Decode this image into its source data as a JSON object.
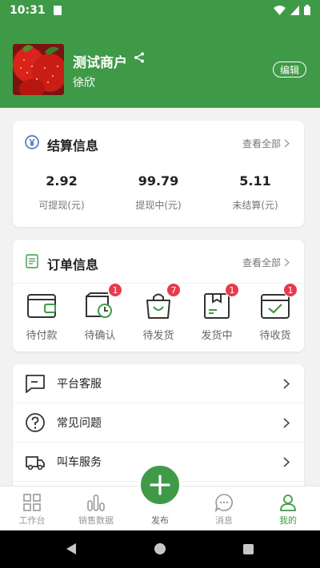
{
  "status_bar": {
    "time": "10:31"
  },
  "header": {
    "shop_name": "测试商户",
    "user_name": "徐欣",
    "edit_label": "编辑"
  },
  "settlement": {
    "title": "结算信息",
    "view_all": "查看全部",
    "items": [
      {
        "value": "2.92",
        "label": "可提现(元)"
      },
      {
        "value": "99.79",
        "label": "提现中(元)"
      },
      {
        "value": "5.11",
        "label": "未结算(元)"
      }
    ]
  },
  "orders": {
    "title": "订单信息",
    "view_all": "查看全部",
    "items": [
      {
        "label": "待付款",
        "icon": "wallet-icon",
        "badge": ""
      },
      {
        "label": "待确认",
        "icon": "truck-clock-icon",
        "badge": "1"
      },
      {
        "label": "待发货",
        "icon": "shopping-bag-icon",
        "badge": "7"
      },
      {
        "label": "发货中",
        "icon": "package-icon",
        "badge": "1"
      },
      {
        "label": "待收货",
        "icon": "check-box-icon",
        "badge": "1"
      }
    ]
  },
  "menu": {
    "items": [
      {
        "label": "平台客服",
        "icon": "chat-icon"
      },
      {
        "label": "常见问题",
        "icon": "question-icon"
      },
      {
        "label": "叫车服务",
        "icon": "truck-icon"
      }
    ]
  },
  "tabbar": {
    "items": [
      {
        "label": "工作台",
        "icon": "grid-icon"
      },
      {
        "label": "销售数据",
        "icon": "bar-chart-icon"
      },
      {
        "label": "发布",
        "icon": "plus-icon"
      },
      {
        "label": "消息",
        "icon": "message-icon"
      },
      {
        "label": "我的",
        "icon": "user-icon"
      }
    ],
    "active": "我的"
  },
  "colors": {
    "brand": "#3f9a47",
    "badge": "#e83a4b"
  }
}
